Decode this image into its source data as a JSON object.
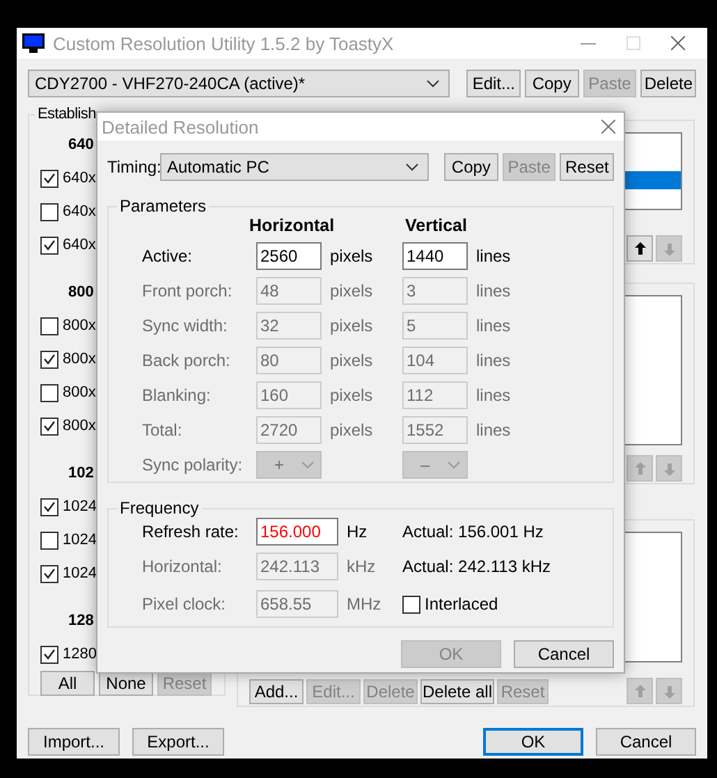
{
  "window": {
    "title": "Custom Resolution Utility 1.5.2 by ToastyX"
  },
  "monitor_select": {
    "value": "CDY2700 - VHF270-240CA (active)*"
  },
  "monitor_buttons": [
    {
      "label": "Edit...",
      "disabled": false
    },
    {
      "label": "Copy",
      "disabled": false
    },
    {
      "label": "Paste",
      "disabled": true
    },
    {
      "label": "Delete",
      "disabled": false
    }
  ],
  "established": {
    "title": "Establish",
    "groups": [
      {
        "heading": "640",
        "items": [
          {
            "label": "640x",
            "checked": true
          },
          {
            "label": "640x",
            "checked": false
          },
          {
            "label": "640x",
            "checked": true
          }
        ]
      },
      {
        "heading": "800",
        "items": [
          {
            "label": "800x",
            "checked": false
          },
          {
            "label": "800x",
            "checked": true
          },
          {
            "label": "800x",
            "checked": false
          },
          {
            "label": "800x",
            "checked": true
          }
        ]
      },
      {
        "heading": "102",
        "items": [
          {
            "label": "1024",
            "checked": true
          },
          {
            "label": "1024",
            "checked": false
          },
          {
            "label": "1024",
            "checked": true
          }
        ]
      },
      {
        "heading": "128",
        "items": [
          {
            "label": "1280",
            "checked": true
          }
        ]
      }
    ],
    "buttons": [
      {
        "label": "All",
        "disabled": false
      },
      {
        "label": "None",
        "disabled": false
      },
      {
        "label": "Reset",
        "disabled": true
      }
    ]
  },
  "lists": [
    {
      "rows": [
        {
          "selected": false
        },
        {
          "selected": false
        },
        {
          "selected": true
        }
      ],
      "arrows": [
        {
          "kind": "up",
          "disabled": false
        },
        {
          "kind": "down",
          "disabled": true
        }
      ]
    },
    {
      "arrows": [
        {
          "kind": "up",
          "disabled": true
        },
        {
          "kind": "down",
          "disabled": true
        }
      ]
    },
    {
      "arrows": [
        {
          "kind": "up",
          "disabled": true
        },
        {
          "kind": "down",
          "disabled": true
        }
      ],
      "buttons": [
        {
          "label": "Add...",
          "disabled": false
        },
        {
          "label": "Edit...",
          "disabled": true
        },
        {
          "label": "Delete",
          "disabled": true
        },
        {
          "label": "Delete all",
          "disabled": false
        },
        {
          "label": "Reset",
          "disabled": true
        }
      ]
    }
  ],
  "footer": {
    "left": [
      {
        "label": "Import..."
      },
      {
        "label": "Export..."
      }
    ],
    "right": [
      {
        "label": "OK",
        "default": true
      },
      {
        "label": "Cancel",
        "default": false
      }
    ]
  },
  "dialog": {
    "title": "Detailed Resolution",
    "timing": {
      "label": "Timing:",
      "value": "Automatic PC"
    },
    "timing_buttons": [
      {
        "label": "Copy",
        "disabled": false
      },
      {
        "label": "Paste",
        "disabled": true
      },
      {
        "label": "Reset",
        "disabled": false
      }
    ],
    "parameters": {
      "title": "Parameters",
      "column_headers": [
        "Horizontal",
        "Vertical"
      ],
      "rows": [
        {
          "label": "Active:",
          "kind": "field",
          "disabled": false,
          "horizontal": "2560",
          "horizontal_unit": "pixels",
          "vertical": "1440",
          "vertical_unit": "lines"
        },
        {
          "label": "Front porch:",
          "kind": "field",
          "disabled": true,
          "horizontal": "48",
          "horizontal_unit": "pixels",
          "vertical": "3",
          "vertical_unit": "lines"
        },
        {
          "label": "Sync width:",
          "kind": "field",
          "disabled": true,
          "horizontal": "32",
          "horizontal_unit": "pixels",
          "vertical": "5",
          "vertical_unit": "lines"
        },
        {
          "label": "Back porch:",
          "kind": "field",
          "disabled": true,
          "horizontal": "80",
          "horizontal_unit": "pixels",
          "vertical": "104",
          "vertical_unit": "lines"
        },
        {
          "label": "Blanking:",
          "kind": "field",
          "disabled": true,
          "horizontal": "160",
          "horizontal_unit": "pixels",
          "vertical": "112",
          "vertical_unit": "lines"
        },
        {
          "label": "Total:",
          "kind": "field",
          "disabled": true,
          "horizontal": "2720",
          "horizontal_unit": "pixels",
          "vertical": "1552",
          "vertical_unit": "lines"
        },
        {
          "label": "Sync polarity:",
          "kind": "select",
          "disabled": true,
          "horizontal": "+",
          "vertical": "–"
        }
      ]
    },
    "frequency": {
      "title": "Frequency",
      "rows": [
        {
          "label": "Refresh rate:",
          "value": "156.000",
          "unit": "Hz",
          "disabled": false,
          "invalid": true,
          "actual": "Actual: 156.001 Hz"
        },
        {
          "label": "Horizontal:",
          "value": "242.113",
          "unit": "kHz",
          "disabled": true,
          "invalid": false,
          "actual": "Actual: 242.113 kHz"
        },
        {
          "label": "Pixel clock:",
          "value": "658.55",
          "unit": "MHz",
          "disabled": true,
          "invalid": false
        }
      ],
      "interlaced": {
        "label": "Interlaced",
        "checked": false
      }
    },
    "buttons": [
      {
        "label": "OK",
        "disabled": true
      },
      {
        "label": "Cancel",
        "disabled": false
      }
    ]
  }
}
